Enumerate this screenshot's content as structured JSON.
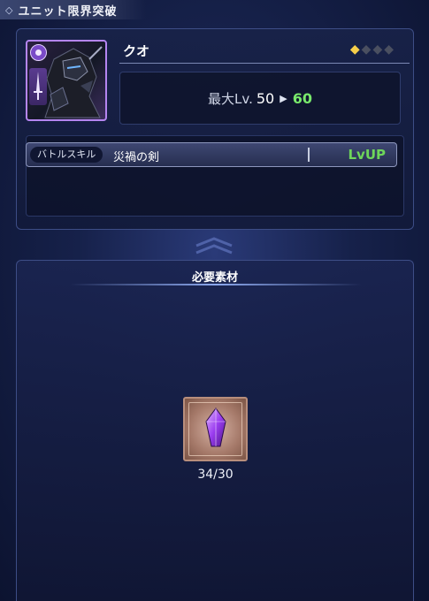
{
  "header": {
    "title": "ユニット限界突破"
  },
  "unit": {
    "name": "クオ",
    "stars_total": 4,
    "stars_filled": 1,
    "level_label": "最大Lv.",
    "level_current": "50",
    "level_next": "60"
  },
  "skill": {
    "tag": "バトルスキル",
    "name": "災禍の剣",
    "action": "LvUP"
  },
  "materials": {
    "title": "必要素材",
    "items": [
      {
        "icon": "purple-crystal-icon",
        "count": "34/30"
      }
    ]
  },
  "colors": {
    "level_next": "#78e86b",
    "lvup": "#6ed65a",
    "star_on": "#f7cf4a",
    "portrait_border": "#b585f0",
    "gem": "#9b3df0"
  }
}
